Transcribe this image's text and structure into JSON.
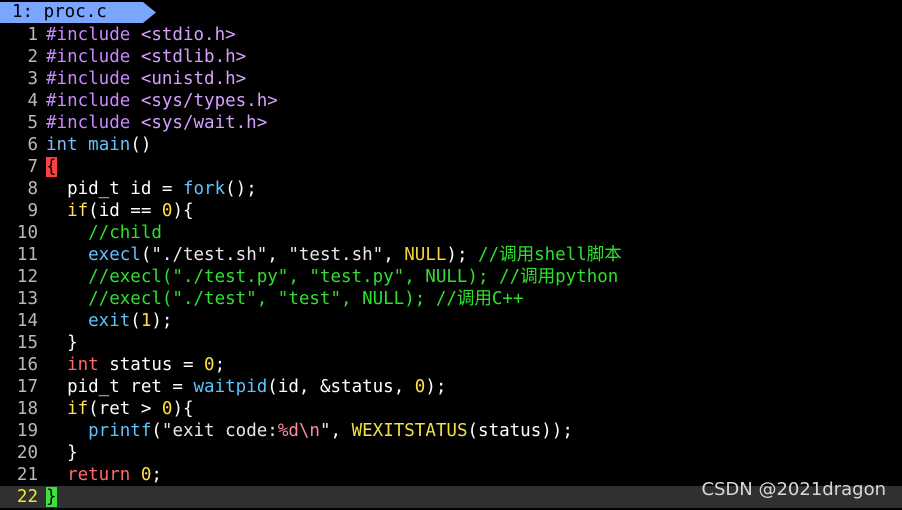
{
  "tab": {
    "label": "1: proc.c"
  },
  "lines": [
    {
      "n": "1",
      "segs": [
        {
          "c": "pp",
          "t": "#include "
        },
        {
          "c": "inc",
          "t": "<stdio.h>"
        }
      ]
    },
    {
      "n": "2",
      "segs": [
        {
          "c": "pp",
          "t": "#include "
        },
        {
          "c": "inc",
          "t": "<stdlib.h>"
        }
      ]
    },
    {
      "n": "3",
      "segs": [
        {
          "c": "pp",
          "t": "#include "
        },
        {
          "c": "inc",
          "t": "<unistd.h>"
        }
      ]
    },
    {
      "n": "4",
      "segs": [
        {
          "c": "pp",
          "t": "#include "
        },
        {
          "c": "inc",
          "t": "<sys/types.h>"
        }
      ]
    },
    {
      "n": "5",
      "segs": [
        {
          "c": "pp",
          "t": "#include "
        },
        {
          "c": "inc",
          "t": "<sys/wait.h>"
        }
      ]
    },
    {
      "n": "6",
      "segs": [
        {
          "c": "ty",
          "t": "int"
        },
        {
          "c": "",
          "t": " "
        },
        {
          "c": "fn",
          "t": "main"
        },
        {
          "c": "",
          "t": "()"
        }
      ]
    },
    {
      "n": "7",
      "segs": [
        {
          "c": "brace-open",
          "t": "{"
        }
      ]
    },
    {
      "n": "8",
      "segs": [
        {
          "c": "",
          "t": "  pid_t id = "
        },
        {
          "c": "fn",
          "t": "fork"
        },
        {
          "c": "",
          "t": "();"
        }
      ]
    },
    {
      "n": "9",
      "segs": [
        {
          "c": "kw",
          "t": "  if"
        },
        {
          "c": "",
          "t": "(id == "
        },
        {
          "c": "num",
          "t": "0"
        },
        {
          "c": "",
          "t": "){"
        }
      ]
    },
    {
      "n": "10",
      "segs": [
        {
          "c": "cm",
          "t": "    //child"
        }
      ]
    },
    {
      "n": "11",
      "segs": [
        {
          "c": "fn",
          "t": "    execl"
        },
        {
          "c": "",
          "t": "("
        },
        {
          "c": "str",
          "t": "\"./test.sh\""
        },
        {
          "c": "",
          "t": ", "
        },
        {
          "c": "str",
          "t": "\"test.sh\""
        },
        {
          "c": "",
          "t": ", "
        },
        {
          "c": "null",
          "t": "NULL"
        },
        {
          "c": "",
          "t": "); "
        },
        {
          "c": "cm",
          "t": "//调用shell脚本"
        }
      ]
    },
    {
      "n": "12",
      "segs": [
        {
          "c": "cm",
          "t": "    //execl(\"./test.py\", \"test.py\", NULL); //调用python"
        }
      ]
    },
    {
      "n": "13",
      "segs": [
        {
          "c": "cm",
          "t": "    //execl(\"./test\", \"test\", NULL); //调用C++"
        }
      ]
    },
    {
      "n": "14",
      "segs": [
        {
          "c": "fn",
          "t": "    exit"
        },
        {
          "c": "",
          "t": "("
        },
        {
          "c": "num",
          "t": "1"
        },
        {
          "c": "",
          "t": ");"
        }
      ]
    },
    {
      "n": "15",
      "segs": [
        {
          "c": "",
          "t": "  }"
        }
      ]
    },
    {
      "n": "16",
      "segs": [
        {
          "c": "st",
          "t": "  int"
        },
        {
          "c": "",
          "t": " status = "
        },
        {
          "c": "num",
          "t": "0"
        },
        {
          "c": "",
          "t": ";"
        }
      ]
    },
    {
      "n": "17",
      "segs": [
        {
          "c": "",
          "t": "  pid_t ret = "
        },
        {
          "c": "fn",
          "t": "waitpid"
        },
        {
          "c": "",
          "t": "(id, &status, "
        },
        {
          "c": "num",
          "t": "0"
        },
        {
          "c": "",
          "t": ");"
        }
      ]
    },
    {
      "n": "18",
      "segs": [
        {
          "c": "kw",
          "t": "  if"
        },
        {
          "c": "",
          "t": "(ret > "
        },
        {
          "c": "num",
          "t": "0"
        },
        {
          "c": "",
          "t": "){"
        }
      ]
    },
    {
      "n": "19",
      "segs": [
        {
          "c": "fn",
          "t": "    printf"
        },
        {
          "c": "",
          "t": "("
        },
        {
          "c": "str",
          "t": "\"exit code:"
        },
        {
          "c": "fmt",
          "t": "%d\\n"
        },
        {
          "c": "str",
          "t": "\""
        },
        {
          "c": "",
          "t": ", "
        },
        {
          "c": "macro",
          "t": "WEXITSTATUS"
        },
        {
          "c": "",
          "t": "(status));"
        }
      ]
    },
    {
      "n": "20",
      "segs": [
        {
          "c": "",
          "t": "  }"
        }
      ]
    },
    {
      "n": "21",
      "segs": [
        {
          "c": "st",
          "t": "  return"
        },
        {
          "c": "",
          "t": " "
        },
        {
          "c": "num",
          "t": "0"
        },
        {
          "c": "",
          "t": ";"
        }
      ]
    },
    {
      "n": "22",
      "current": true,
      "segs": [
        {
          "c": "brace-cur",
          "t": "}"
        }
      ]
    }
  ],
  "watermark": "CSDN @2021dragon"
}
